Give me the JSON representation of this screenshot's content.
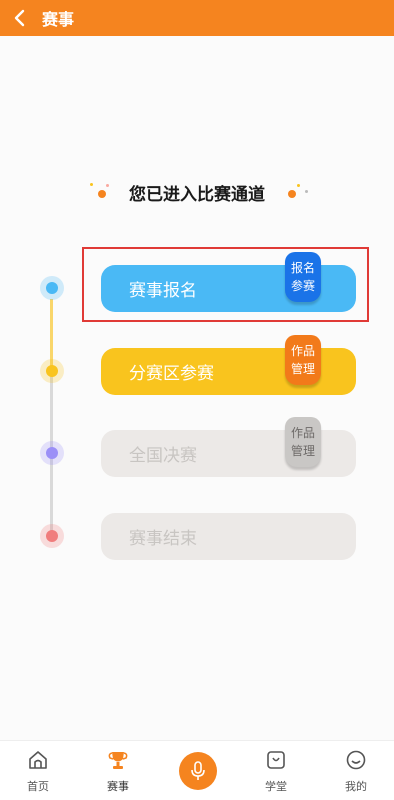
{
  "header": {
    "title": "赛事"
  },
  "hero": {
    "title": "您已进入比赛通道"
  },
  "stages": [
    {
      "label": "赛事报名",
      "badge": [
        "报名",
        "参赛"
      ],
      "color": "#4ab9f5",
      "badge_color": "#1a73e8",
      "node_color": "#4ab9f5"
    },
    {
      "label": "分赛区参赛",
      "badge": [
        "作品",
        "管理"
      ],
      "color": "#f9c41e",
      "badge_color": "#f27a1a",
      "node_color": "#f9c41e"
    },
    {
      "label": "全国决赛",
      "badge": [
        "作品",
        "管理"
      ],
      "color": "#ece9e7",
      "badge_color": "#c9c7c5",
      "node_color": "#9b8ff7"
    },
    {
      "label": "赛事结束",
      "color": "#ece9e7",
      "node_color": "#f07d7d"
    }
  ],
  "tabbar": {
    "items": [
      {
        "label": "首页",
        "icon": "home-icon"
      },
      {
        "label": "赛事",
        "icon": "trophy-icon"
      },
      {
        "label": "",
        "icon": "microphone-icon"
      },
      {
        "label": "学堂",
        "icon": "book-icon"
      },
      {
        "label": "我的",
        "icon": "smile-icon"
      }
    ]
  }
}
